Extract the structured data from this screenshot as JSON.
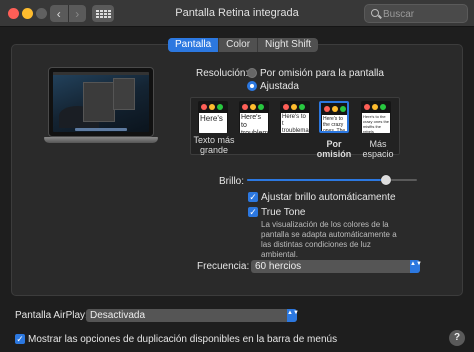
{
  "window": {
    "title": "Pantalla Retina integrada",
    "back_glyph": "‹",
    "forward_glyph": "›",
    "search_placeholder": "Buscar"
  },
  "tabs": [
    {
      "label": "Pantalla",
      "active": true
    },
    {
      "label": "Color",
      "active": false
    },
    {
      "label": "Night Shift",
      "active": false
    }
  ],
  "resolution": {
    "label": "Resolución:",
    "options": [
      {
        "label": "Por omisión para la pantalla",
        "selected": false
      },
      {
        "label": "Ajustada",
        "selected": true
      }
    ],
    "scales": [
      {
        "label": "Texto más grande",
        "preview": "Here's",
        "selected": false
      },
      {
        "label": "",
        "preview": "Here's to troublem",
        "selected": false
      },
      {
        "label": "",
        "preview": "Here's to t troublema ones who",
        "selected": false
      },
      {
        "label": "Por omisión",
        "preview": "Here's to the crazy ones. The rules. And",
        "selected": true
      },
      {
        "label": "Más espacio",
        "preview": "Here's to the crazy ones the misfits the rebels",
        "selected": false
      }
    ]
  },
  "brightness": {
    "label": "Brillo:",
    "value": 0.82,
    "auto_label": "Ajustar brillo automáticamente",
    "auto_checked": true,
    "truetone_label": "True Tone",
    "truetone_checked": true,
    "truetone_desc": "La visualización de los colores de la pantalla se adapta automáticamente a las distintas condiciones de luz ambiental."
  },
  "refresh": {
    "label": "Frecuencia:",
    "value": "60 hercios"
  },
  "airplay": {
    "label": "Pantalla AirPlay:",
    "value": "Desactivada"
  },
  "mirroring": {
    "label": "Mostrar las opciones de duplicación disponibles en la barra de menús",
    "checked": true
  },
  "help_glyph": "?",
  "check_glyph": "✓",
  "popup_arrows": "▲▼",
  "colors": {
    "accent": "#2c78e0",
    "background": "#1e1e1e",
    "pane": "#2a2a2a"
  }
}
